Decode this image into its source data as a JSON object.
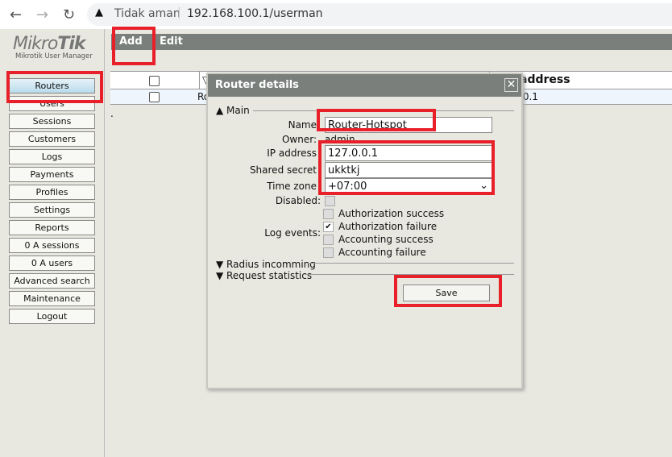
{
  "browser": {
    "security": "Tidak aman",
    "url": "192.168.100.1/userman"
  },
  "logo": {
    "brand": "MikroTik",
    "subtitle": "Mikrotik User Manager"
  },
  "sidebar": [
    "Routers",
    "Users",
    "Sessions",
    "Customers",
    "Logs",
    "Payments",
    "Profiles",
    "Settings",
    "Reports",
    "0 A sessions",
    "0 A users",
    "Advanced search",
    "Maintenance",
    "Logout"
  ],
  "menu": {
    "add": "Add",
    "edit": "Edit"
  },
  "table": {
    "header_address": "address",
    "row_name": "Ro",
    "row_address": ".0.1",
    "dot": "."
  },
  "dialog": {
    "title": "Router details",
    "close": "✕",
    "main_section": "Main",
    "name_label": "Name",
    "name_value": "Router-Hotspot",
    "owner_label": "Owner:",
    "owner_value": "admin",
    "ip_label": "IP address",
    "ip_value": "127.0.0.1",
    "secret_label": "Shared secret",
    "secret_value": "ukktkj",
    "tz_label": "Time zone",
    "tz_value": "+07:00",
    "disabled_label": "Disabled:",
    "log_label": "Log events:",
    "log_events": [
      {
        "label": "Authorization success",
        "checked": false
      },
      {
        "label": "Authorization failure",
        "checked": true
      },
      {
        "label": "Accounting success",
        "checked": false
      },
      {
        "label": "Accounting failure",
        "checked": false
      }
    ],
    "radius_section": "Radius incomming",
    "stats_section": "Request statistics",
    "save": "Save"
  },
  "colors": {
    "highlight": "#e8202a",
    "titlebar": "#7a7f7c"
  }
}
